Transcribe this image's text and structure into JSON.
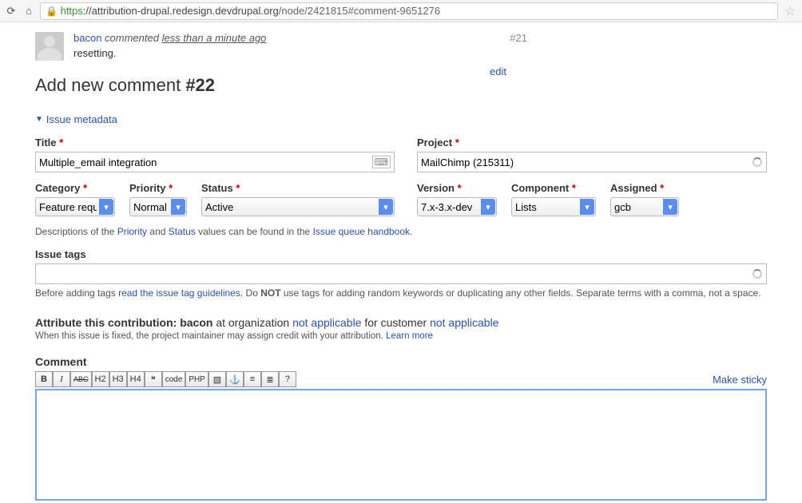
{
  "browser": {
    "url_secure": "https",
    "url_host": "://attribution-drupal.redesign.devdrupal.org",
    "url_path": "/node/2421815#comment-9651276"
  },
  "prev_comment": {
    "author": "bacon",
    "verb": "commented",
    "time": "less than a minute ago",
    "body": "resetting.",
    "number": "#21",
    "edit_label": "edit"
  },
  "heading": {
    "prefix": "Add new comment ",
    "number": "#22"
  },
  "metadata_toggle": "Issue metadata",
  "labels": {
    "title": "Title",
    "project": "Project",
    "category": "Category",
    "priority": "Priority",
    "status": "Status",
    "version": "Version",
    "component": "Component",
    "assigned": "Assigned",
    "issue_tags": "Issue tags",
    "comment": "Comment"
  },
  "values": {
    "title": "Multiple_email integration",
    "project": "MailChimp (215311)",
    "category": "Feature requ",
    "priority": "Normal",
    "status": "Active",
    "version": "7.x-3.x-dev",
    "component": "Lists",
    "assigned": "gcb",
    "issue_tags": ""
  },
  "help": {
    "desc_prefix": "Descriptions of the ",
    "priority_link": "Priority",
    "desc_mid": " and ",
    "status_link": "Status",
    "desc_suffix": " values can be found in the ",
    "handbook_link": "Issue queue handbook",
    "desc_end": ".",
    "tags_prefix": "Before adding tags ",
    "tags_link": "read the issue tag guidelines",
    "tags_mid": ". Do ",
    "tags_not": "NOT",
    "tags_suffix": " use tags for adding random keywords or duplicating any other fields. Separate terms with a comma, not a space."
  },
  "attribution": {
    "label": "Attribute this contribution:",
    "user": "bacon",
    "at_org": " at organization ",
    "org_value": "not applicable",
    "for_cust": " for customer ",
    "cust_value": "not applicable",
    "help_text": "When this issue is fixed, the project maintainer may assign credit with your attribution. ",
    "learn_more": "Learn more"
  },
  "editor": {
    "make_sticky": "Make sticky",
    "buttons": {
      "bold": "B",
      "italic": "I",
      "strike": "ABC",
      "h2": "H2",
      "h3": "H3",
      "h4": "H4",
      "quote": "❝",
      "code": "code",
      "php": "PHP",
      "img": "▧",
      "link": "⚓",
      "ul": "≡",
      "ol": "≣",
      "help": "?"
    }
  }
}
